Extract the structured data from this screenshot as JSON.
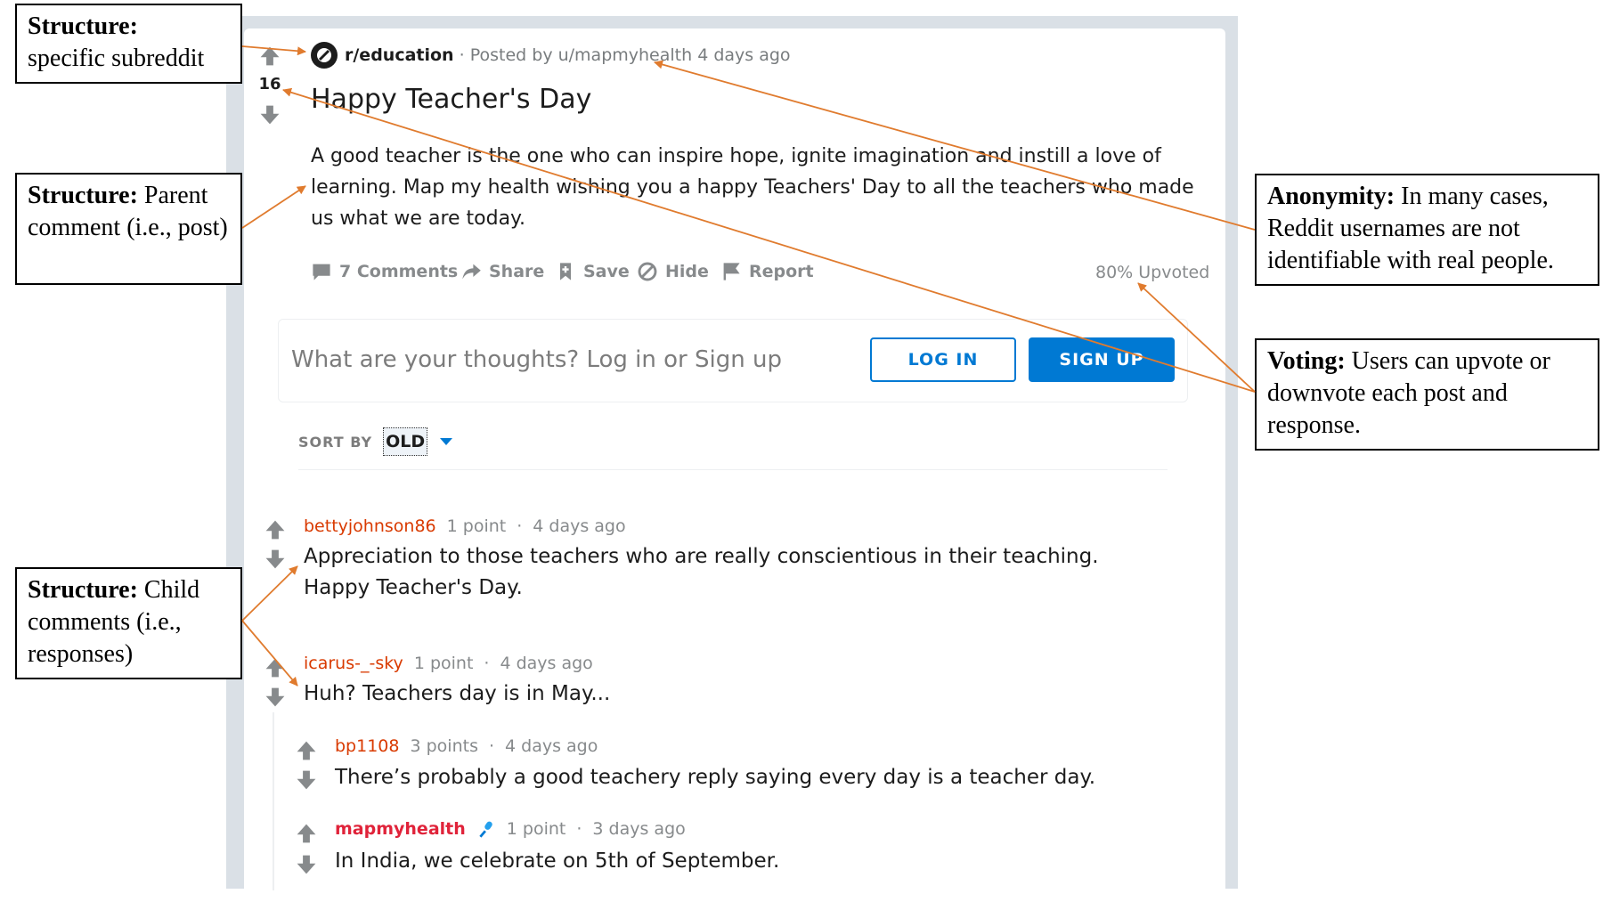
{
  "post": {
    "subreddit": "r/education",
    "posted_by": "· Posted by u/mapmyhealth 4 days ago",
    "score": "16",
    "title": "Happy Teacher's Day",
    "body": "A good teacher is the one who can inspire hope, ignite imagination and instill a love of learning. Map my health wishing you a happy Teachers' Day to all the teachers who made us what we are today.",
    "actions": {
      "comments": "7 Comments",
      "share": "Share",
      "save": "Save",
      "hide": "Hide",
      "report": "Report"
    },
    "upvoted": "80% Upvoted"
  },
  "comment_box": {
    "placeholder": "What are your thoughts? Log in or Sign up",
    "login": "LOG IN",
    "signup": "SIGN UP"
  },
  "sort": {
    "label": "SORT BY",
    "value": "OLD"
  },
  "comments": [
    {
      "user": "bettyjohnson86",
      "points": "1 point",
      "sep": "·",
      "time": "4 days ago",
      "text": "Appreciation to those teachers who are really conscientious in their teaching. Happy Teacher's Day."
    },
    {
      "user": "icarus-_-sky",
      "points": "1 point",
      "sep": "·",
      "time": "4 days ago",
      "text": "Huh? Teachers day is in May..."
    },
    {
      "user": "bp1108",
      "points": "3 points",
      "sep": "·",
      "time": "4 days ago",
      "text": "There’s probably a good teachery reply saying every day is a teacher day."
    },
    {
      "user": "mapmyhealth",
      "points": "1 point",
      "sep": "·",
      "time": "3 days ago",
      "text": "In India, we celebrate on 5th of September."
    }
  ],
  "annotations": {
    "subreddit": {
      "bold": "Structure:",
      "text": "specific subreddit"
    },
    "parent": {
      "bold": "Structure:",
      "text": "Parent comment (i.e., post)"
    },
    "child": {
      "bold": "Structure:",
      "text": "Child comments (i.e., responses)"
    },
    "anonymity": {
      "bold": "Anonymity:",
      "text": "In many cases, Reddit usernames are not identifiable with real people."
    },
    "voting": {
      "bold": "Voting:",
      "text": "Users can upvote or downvote each post and response."
    }
  },
  "colors": {
    "arrow": "#e07b2e",
    "brand_blue": "#0079d3",
    "username": "#d93a00",
    "vote_gray": "#878a8c"
  }
}
